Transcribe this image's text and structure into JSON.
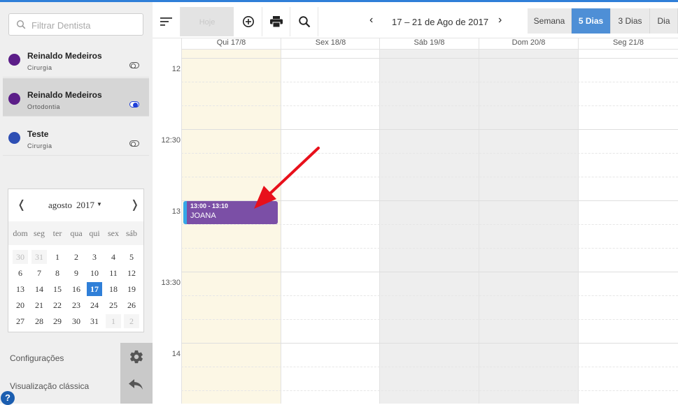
{
  "search": {
    "placeholder": "Filtrar Dentista"
  },
  "dentists": [
    {
      "name": "Reinaldo Medeiros",
      "specialty": "Cirurgia",
      "color": "#5b1d88",
      "enabled": false
    },
    {
      "name": "Reinaldo Medeiros",
      "specialty": "Ortodontia",
      "color": "#5b1d88",
      "enabled": true
    },
    {
      "name": "Teste",
      "specialty": "Cirurgia",
      "color": "#2e4fb4",
      "enabled": false
    }
  ],
  "mini_calendar": {
    "month": "agosto",
    "year": "2017",
    "prev_icon": "❬",
    "next_icon": "❭",
    "weekdays": [
      "dom",
      "seg",
      "ter",
      "qua",
      "qui",
      "sex",
      "sáb"
    ],
    "weeks": [
      [
        "30",
        "31",
        "1",
        "2",
        "3",
        "4",
        "5"
      ],
      [
        "6",
        "7",
        "8",
        "9",
        "10",
        "11",
        "12"
      ],
      [
        "13",
        "14",
        "15",
        "16",
        "17",
        "18",
        "19"
      ],
      [
        "20",
        "21",
        "22",
        "23",
        "24",
        "25",
        "26"
      ],
      [
        "27",
        "28",
        "29",
        "30",
        "31",
        "1",
        "2"
      ]
    ],
    "selected_day": "17"
  },
  "sidebar_links": {
    "settings": "Configurações",
    "classic_view": "Visualização clássica",
    "help": "?"
  },
  "toolbar": {
    "today_label": "Hoje",
    "range_title": "17 – 21 de Ago de 2017",
    "prev_icon": "‹",
    "next_icon": "›",
    "views": [
      "Semana",
      "5 Dias",
      "3 Dias",
      "Dia"
    ],
    "active_view": "5 Dias"
  },
  "calendar": {
    "day_headers": [
      "Qui 17/8",
      "Sex 18/8",
      "Sáb 19/8",
      "Dom 20/8",
      "Seg 21/8"
    ],
    "time_labels": [
      "12",
      "12:30",
      "13",
      "13:30",
      "14"
    ],
    "today_color": "#fcf7e5",
    "weekend_color": "#eeeeee"
  },
  "event": {
    "time": "13:00 - 13:10",
    "title": "JOANA",
    "color": "#7b4fa6",
    "accent": "#35a8e8"
  },
  "annotation": {
    "arrow_color": "#e8101b"
  }
}
